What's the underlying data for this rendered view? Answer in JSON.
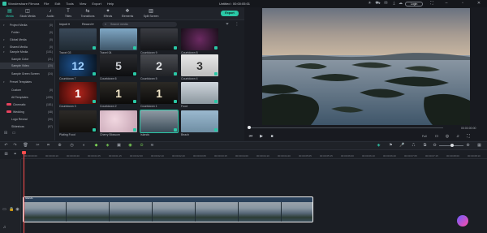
{
  "titlebar": {
    "app_name": "Wondershare Filmora",
    "menu": [
      "File",
      "Edit",
      "Tools",
      "View",
      "Export",
      "Help"
    ],
    "document_title": "Untitled : 00:00:05:01",
    "login_label": "Login"
  },
  "toolbar": {
    "tabs": [
      {
        "label": "Media",
        "icon": "folder-icon",
        "active": true
      },
      {
        "label": "Stock Media",
        "icon": "stock-icon",
        "active": false
      },
      {
        "label": "Audio",
        "icon": "music-icon",
        "active": false
      },
      {
        "label": "Titles",
        "icon": "titles-icon",
        "active": false
      },
      {
        "label": "Transitions",
        "icon": "transitions-icon",
        "active": false
      },
      {
        "label": "Effects",
        "icon": "effects-icon",
        "active": false
      },
      {
        "label": "Elements",
        "icon": "elements-icon",
        "active": false
      },
      {
        "label": "Split Screen",
        "icon": "split-screen-icon",
        "active": false
      }
    ],
    "export_label": "Export"
  },
  "sidebar": {
    "items": [
      {
        "label": "Project Media",
        "count": "(0)",
        "level": 0
      },
      {
        "label": "Folder",
        "count": "(0)",
        "level": 1
      },
      {
        "label": "Global Media",
        "count": "(0)",
        "level": 0
      },
      {
        "label": "Shared Media",
        "count": "(0)",
        "level": 0
      },
      {
        "label": "Sample Media",
        "count": "(101)",
        "level": 0
      },
      {
        "label": "Sample Color",
        "count": "(21)",
        "level": 1
      },
      {
        "label": "Sample Video",
        "count": "(20)",
        "level": 1,
        "selected": true
      },
      {
        "label": "Sample Green Screen",
        "count": "(24)",
        "level": 1
      },
      {
        "label": "Preset Templates",
        "count": "",
        "level": 0
      },
      {
        "label": "Custom",
        "count": "(0)",
        "level": 1
      },
      {
        "label": "All Templates",
        "count": "(439)",
        "level": 1
      },
      {
        "label": "Cinematic",
        "count": "(181)",
        "level": 1,
        "badge": true
      },
      {
        "label": "Wedding",
        "count": "(48)",
        "level": 1,
        "badge": true
      },
      {
        "label": "Logo Reveal",
        "count": "(30)",
        "level": 1
      },
      {
        "label": "Slideshow",
        "count": "(97)",
        "level": 1
      }
    ]
  },
  "media": {
    "import_label": "Import",
    "record_label": "Record",
    "search_placeholder": "Search media",
    "items": [
      {
        "label": "Travel 03",
        "style": "landscape-dark",
        "num": ""
      },
      {
        "label": "Travel 04",
        "style": "city",
        "num": ""
      },
      {
        "label": "Countdown 9",
        "style": "dark-number",
        "num": ""
      },
      {
        "label": "Countdown 8",
        "style": "magenta-number",
        "num": ""
      },
      {
        "label": "Countdown 7",
        "style": "blue-number",
        "num": "12"
      },
      {
        "label": "Countdown 6",
        "style": "silver-number",
        "num": "5"
      },
      {
        "label": "Countdown 5",
        "style": "grey-number",
        "num": "2"
      },
      {
        "label": "Countdown 4",
        "style": "white-number",
        "num": "3"
      },
      {
        "label": "Countdown 3",
        "style": "red-number",
        "num": "1"
      },
      {
        "label": "Countdown 2",
        "style": "film-number",
        "num": "1"
      },
      {
        "label": "Countdown 1",
        "style": "film-number",
        "num": "1"
      },
      {
        "label": "Food",
        "style": "food",
        "num": ""
      },
      {
        "label": "Plating Food",
        "style": "food-dark",
        "num": ""
      },
      {
        "label": "Cherry Blossom",
        "style": "blossom",
        "num": ""
      },
      {
        "label": "Islands",
        "style": "islands",
        "num": "",
        "selected": true
      },
      {
        "label": "Beach",
        "style": "beach",
        "num": ""
      }
    ]
  },
  "preview": {
    "timecode": "00:00:00:00",
    "quality": "Full"
  },
  "timeline": {
    "ticks": [
      "00:00:00:00",
      "00:00:00:10",
      "00:00:00:20",
      "00:00:01:05",
      "00:00:01:15",
      "00:00:02:00",
      "00:00:02:10",
      "00:00:02:20",
      "00:00:03:05",
      "00:00:03:15",
      "00:00:04:00",
      "00:00:04:10",
      "00:00:04:20",
      "00:00:05:05",
      "00:00:05:15",
      "00:00:06:00",
      "00:00:06:10",
      "00:00:06:20",
      "00:00:07:05",
      "00:00:07:15",
      "00:00:08:00",
      "00:00:08:10"
    ],
    "clip_label": "Islands"
  }
}
